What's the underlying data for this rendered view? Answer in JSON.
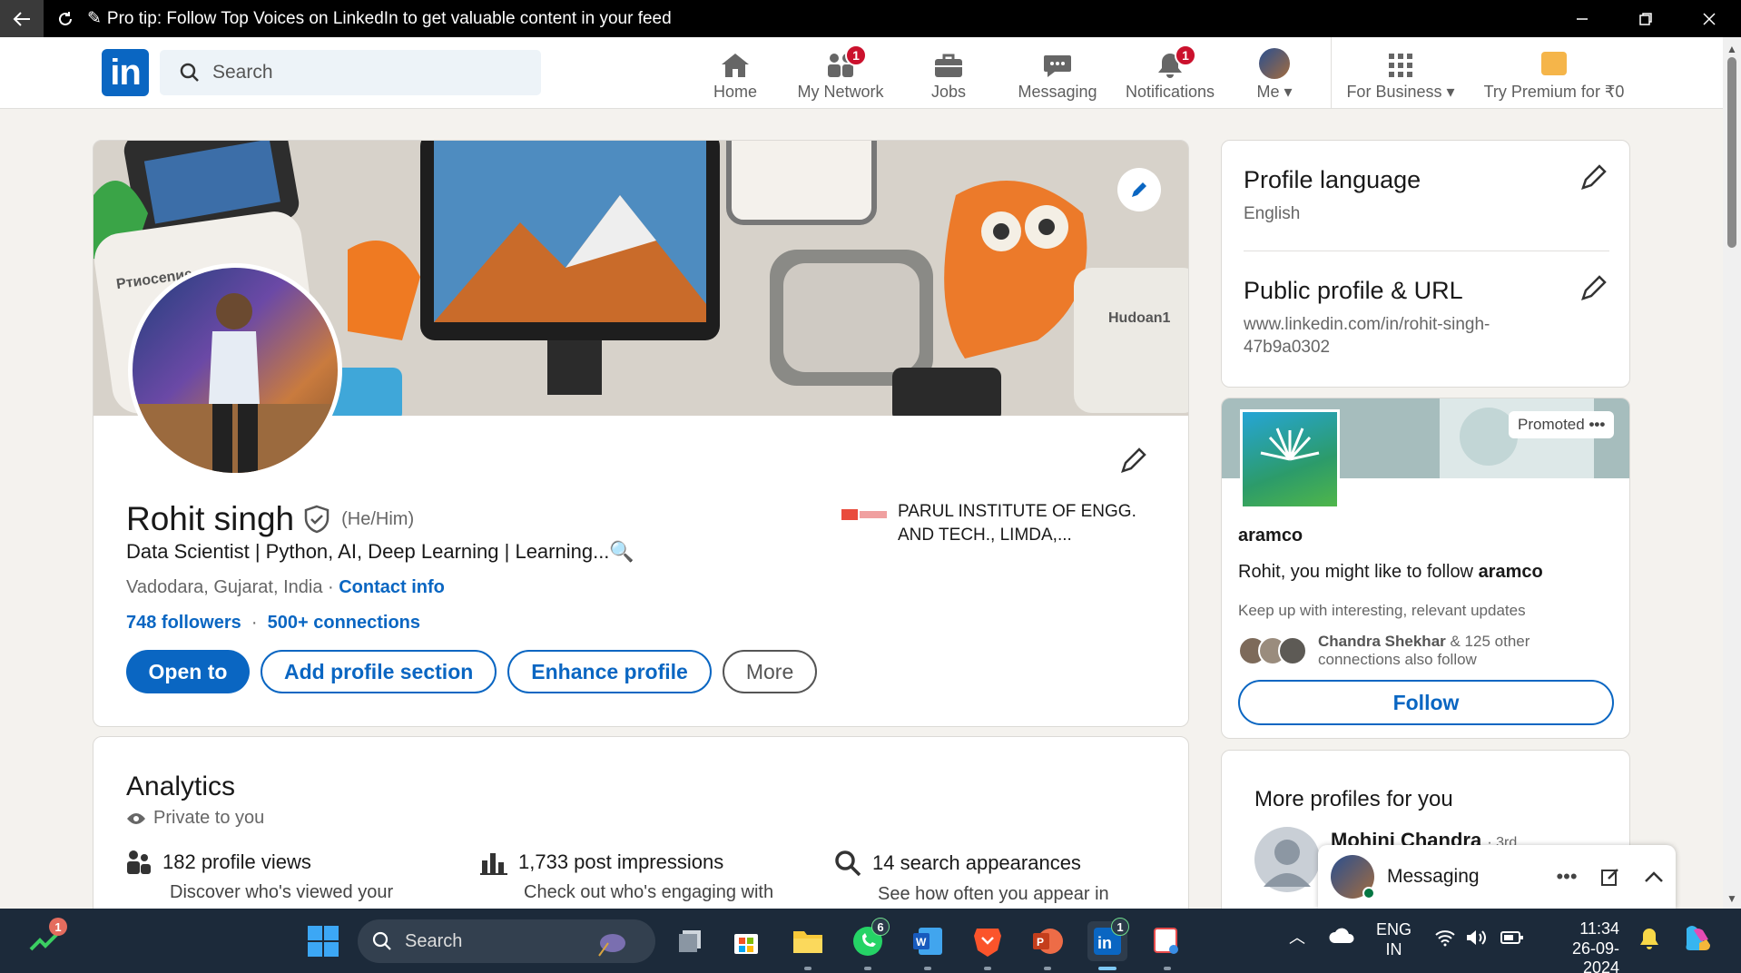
{
  "titlebar": {
    "tip": "Pro tip: Follow Top Voices on LinkedIn to get valuable content in your feed"
  },
  "nav": {
    "logo": "in",
    "search_placeholder": "Search",
    "items": [
      {
        "label": "Home",
        "icon": "home-icon"
      },
      {
        "label": "My Network",
        "icon": "network-icon",
        "badge": "1"
      },
      {
        "label": "Jobs",
        "icon": "briefcase-icon"
      },
      {
        "label": "Messaging",
        "icon": "messaging-icon"
      },
      {
        "label": "Notifications",
        "icon": "bell-icon",
        "badge": "1"
      },
      {
        "label": "Me",
        "icon": "avatar"
      },
      {
        "label": "For Business",
        "icon": "grid-icon"
      },
      {
        "label": "Try Premium for ₹0",
        "icon": "premium-icon"
      }
    ]
  },
  "profile": {
    "name": "Rohit singh",
    "pronouns": "(He/Him)",
    "headline": "Data Scientist | Python, AI, Deep Learning | Learning...🔍",
    "location": "Vadodara, Gujarat, India",
    "location_sep": " · ",
    "contact_info": "Contact info",
    "followers": "748 followers",
    "connections": "500+ connections",
    "education": "PARUL INSTITUTE OF ENGG. AND TECH., LIMDA,...",
    "banner_text_left": "Pтиоcenиe",
    "banner_text_right": "Hudoan1",
    "buttons": {
      "open_to": "Open to",
      "add_section": "Add profile section",
      "enhance": "Enhance profile",
      "more": "More"
    }
  },
  "analytics": {
    "title": "Analytics",
    "visibility": "Private to you",
    "items": [
      {
        "value": "182 profile views",
        "desc": "Discover who's viewed your",
        "icon": "people-icon"
      },
      {
        "value": "1,733 post impressions",
        "desc": "Check out who's engaging with",
        "icon": "bar-chart-icon"
      },
      {
        "value": "14 search appearances",
        "desc": "See how often you appear in",
        "icon": "search-icon"
      }
    ]
  },
  "sidebar": {
    "profile_language": {
      "title": "Profile language",
      "value": "English"
    },
    "public_profile": {
      "title": "Public profile & URL",
      "value_line1": "www.linkedin.com/in/rohit-singh-",
      "value_line2": "47b9a0302"
    },
    "ad": {
      "promoted": "Promoted",
      "company": "aramco",
      "pitch_prefix": "Rohit, you might like to follow ",
      "pitch_company": "aramco",
      "sub": "Keep up with interesting, relevant updates",
      "connection_name": "Chandra Shekhar",
      "connection_rest": " & 125 other",
      "connection_line2": "connections also follow",
      "follow": "Follow"
    },
    "more_profiles": {
      "title": "More profiles for you",
      "first_name": "Mohini Chandra",
      "first_degree": "· 3rd"
    }
  },
  "messaging": {
    "label": "Messaging"
  },
  "taskbar": {
    "search": "Search",
    "badges": {
      "stocks": "1",
      "whatsapp": "6",
      "linkedin": "1"
    },
    "lang1": "ENG",
    "lang2": "IN",
    "time": "11:34",
    "date": "26-09-2024"
  }
}
